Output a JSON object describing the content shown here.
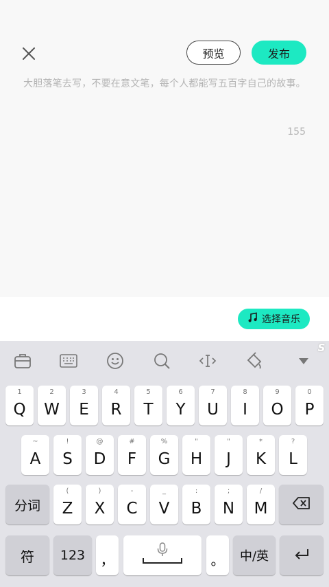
{
  "editor": {
    "close_icon": "close-icon",
    "preview_label": "预览",
    "publish_label": "发布",
    "placeholder": "大胆落笔去写，不要在意文笔，每个人都能写五百字自己的故事。",
    "char_count": "155"
  },
  "music": {
    "icon": "music-note-icon",
    "label": "选择音乐"
  },
  "keyboard": {
    "toolbar": [
      "toolbox-icon",
      "keyboard-icon",
      "emoji-icon",
      "search-icon",
      "cursor-icon",
      "skin-icon",
      "collapse-icon"
    ],
    "row1": [
      {
        "k": "Q",
        "h": "1"
      },
      {
        "k": "W",
        "h": "2"
      },
      {
        "k": "E",
        "h": "3"
      },
      {
        "k": "R",
        "h": "4"
      },
      {
        "k": "T",
        "h": "5"
      },
      {
        "k": "Y",
        "h": "6"
      },
      {
        "k": "U",
        "h": "7"
      },
      {
        "k": "I",
        "h": "8"
      },
      {
        "k": "O",
        "h": "9"
      },
      {
        "k": "P",
        "h": "0"
      }
    ],
    "row2": [
      {
        "k": "A",
        "h": "~"
      },
      {
        "k": "S",
        "h": "!"
      },
      {
        "k": "D",
        "h": "@"
      },
      {
        "k": "F",
        "h": "#"
      },
      {
        "k": "G",
        "h": "%"
      },
      {
        "k": "H",
        "h": "\""
      },
      {
        "k": "J",
        "h": "\""
      },
      {
        "k": "K",
        "h": "*"
      },
      {
        "k": "L",
        "h": "?"
      }
    ],
    "row3": [
      {
        "k": "Z",
        "h": "("
      },
      {
        "k": "X",
        "h": ")"
      },
      {
        "k": "C",
        "h": "-"
      },
      {
        "k": "V",
        "h": "_"
      },
      {
        "k": "B",
        "h": ":"
      },
      {
        "k": "N",
        "h": ";"
      },
      {
        "k": "M",
        "h": "/"
      }
    ],
    "fenci_label": "分词",
    "symbol_label": "符",
    "number_label": "123",
    "comma_label": "，",
    "period_label": "。",
    "lang_label": "中/英"
  },
  "colors": {
    "accent": "#1de9c2",
    "keyboard_bg": "#e3e3e8"
  }
}
